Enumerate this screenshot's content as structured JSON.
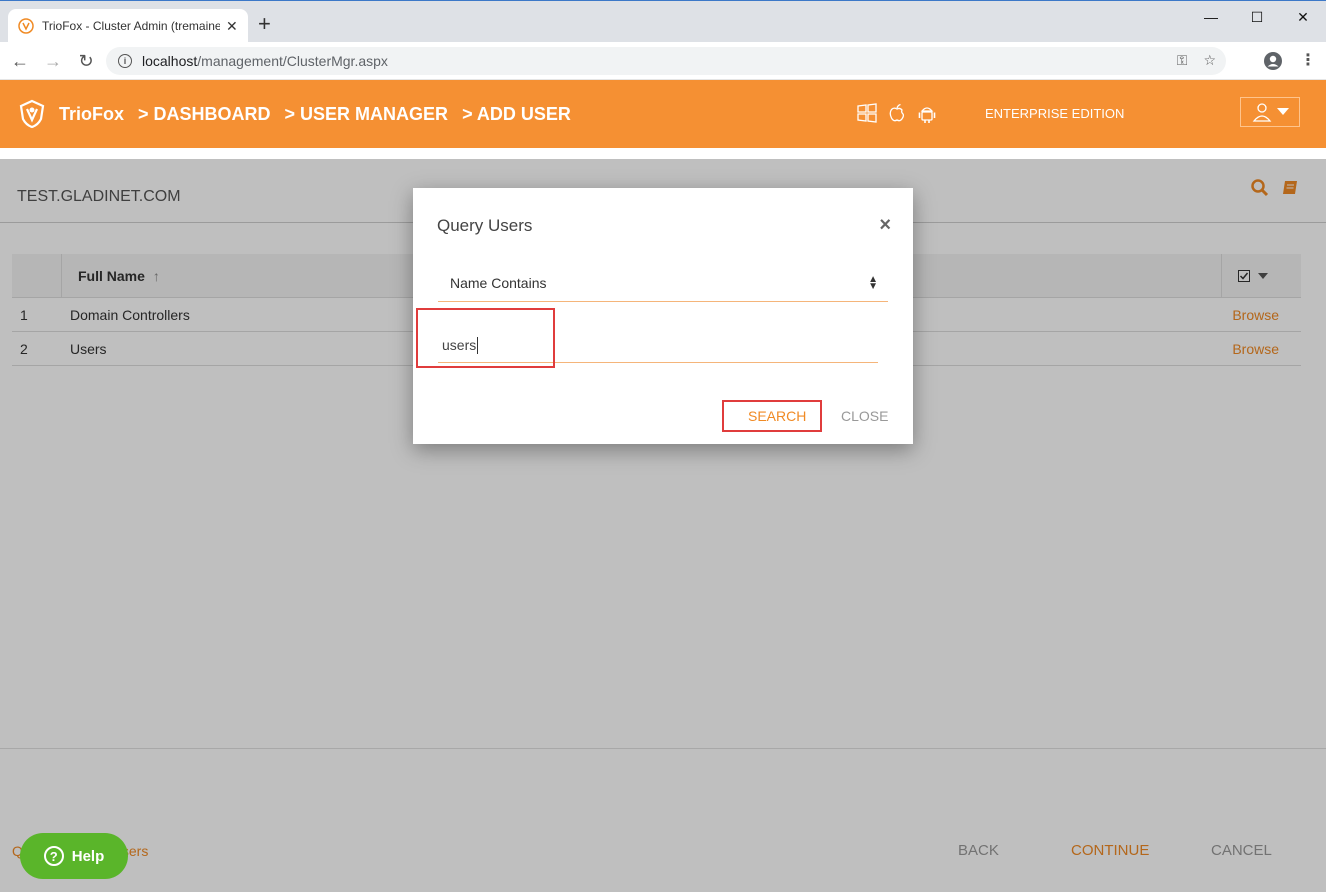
{
  "browser": {
    "tab_title": "TrioFox - Cluster Admin (tremaine",
    "url_host": "localhost",
    "url_path": "/management/ClusterMgr.aspx"
  },
  "app": {
    "brand": "TrioFox",
    "breadcrumbs": [
      "> DASHBOARD",
      "> USER MANAGER",
      "> ADD USER"
    ],
    "edition": "ENTERPRISE EDITION",
    "accent": "#f59033"
  },
  "page": {
    "domain_title": "TEST.GLADINET.COM",
    "grid": {
      "column_name": "Full Name",
      "sort_glyph": "↑",
      "rows": [
        {
          "index": "1",
          "name": "Domain Controllers",
          "action": "Browse"
        },
        {
          "index": "2",
          "name": "Users",
          "action": "Browse"
        }
      ]
    },
    "footer": {
      "link_prefix": "Q",
      "link_suffix": "sers",
      "back": "BACK",
      "continue": "CONTINUE",
      "cancel": "CANCEL"
    },
    "help_label": "Help"
  },
  "modal": {
    "title": "Query Users",
    "close_glyph": "×",
    "filter_selected": "Name Contains",
    "query_value": "users",
    "search_label": "SEARCH",
    "close_label": "CLOSE"
  }
}
